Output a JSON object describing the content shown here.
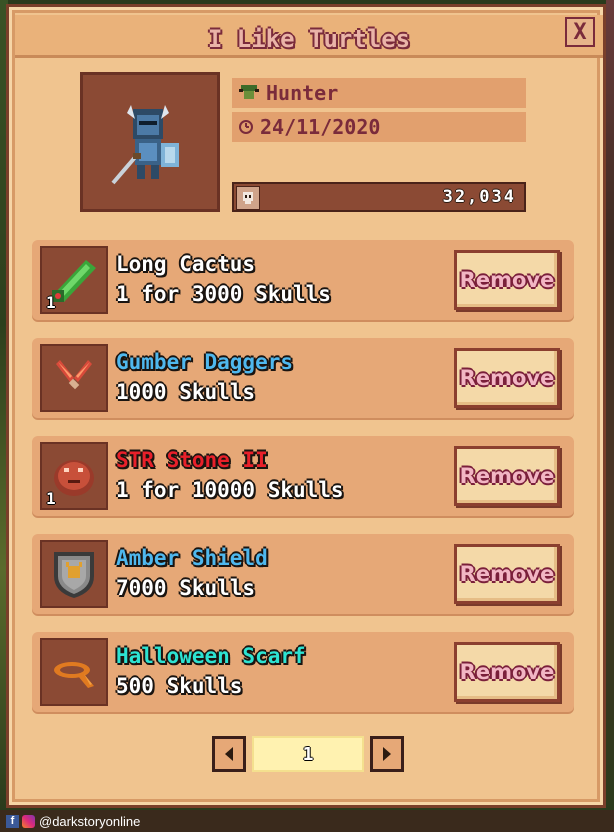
{
  "title": "I Like Turtles",
  "close_label": "X",
  "profile": {
    "class_name": "Hunter",
    "date": "24/11/2020",
    "skulls": "32,034"
  },
  "items": [
    {
      "name": "Long Cactus",
      "price": "1 for 3000 Skulls",
      "quantity": "1",
      "name_color": "#ffffff",
      "icon": "long-cactus-icon"
    },
    {
      "name": "Gumber Daggers",
      "price": "1000 Skulls",
      "quantity": "",
      "name_color": "#4fb8ee",
      "icon": "daggers-icon"
    },
    {
      "name": "STR Stone II",
      "price": "1 for 10000 Skulls",
      "quantity": "1",
      "name_color": "#e8202a",
      "icon": "str-stone-icon"
    },
    {
      "name": "Amber Shield",
      "price": "7000 Skulls",
      "quantity": "",
      "name_color": "#4fb8ee",
      "icon": "amber-shield-icon"
    },
    {
      "name": "Halloween Scarf",
      "price": "500 Skulls",
      "quantity": "",
      "name_color": "#2de3d2",
      "icon": "halloween-scarf-icon"
    }
  ],
  "remove_label": "Remove",
  "pager": {
    "page": "1"
  },
  "footer": {
    "handle": "@darkstoryonline"
  }
}
